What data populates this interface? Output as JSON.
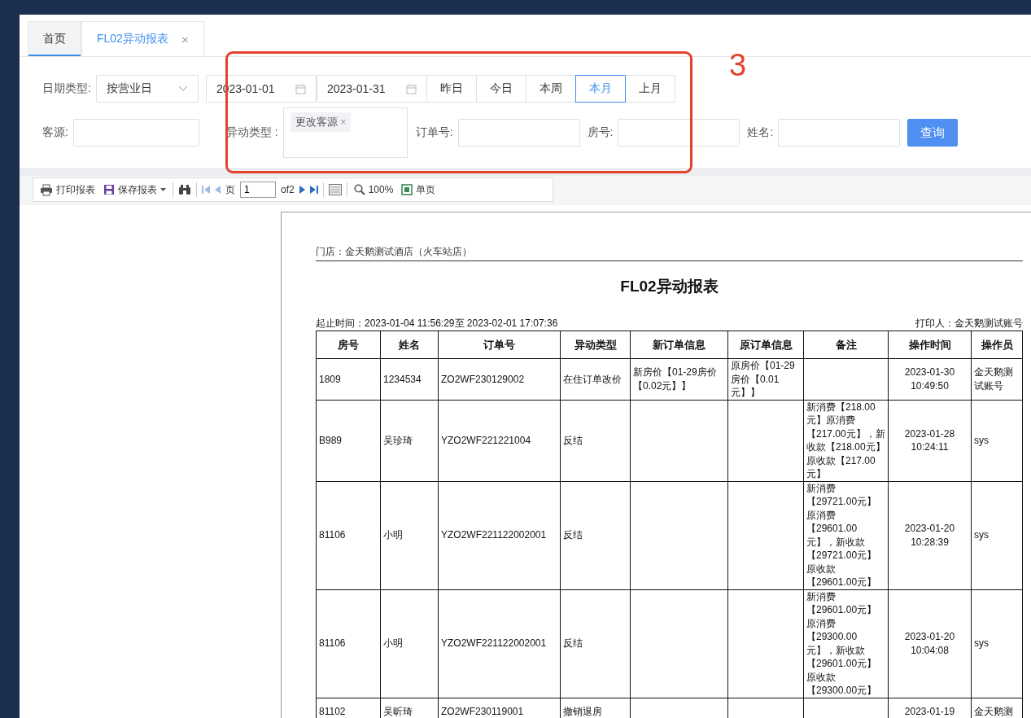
{
  "tabs": [
    {
      "label": "首页",
      "selected": false,
      "underlined": true
    },
    {
      "label": "FL02异动报表",
      "selected": true,
      "underlined": false,
      "close": "×"
    }
  ],
  "filters": {
    "date_type": {
      "label": "日期类型:",
      "value": "按营业日"
    },
    "date_from": "2023-01-01",
    "date_to": "2023-01-31",
    "quick_ranges": [
      {
        "label": "昨日",
        "selected": false
      },
      {
        "label": "今日",
        "selected": false
      },
      {
        "label": "本周",
        "selected": false
      },
      {
        "label": "本月",
        "selected": true
      },
      {
        "label": "上月",
        "selected": false
      }
    ],
    "source": {
      "label": "客源:"
    },
    "change_type": {
      "label": "异动类型 :",
      "tags": [
        {
          "text": "更改客源",
          "remove": "×"
        }
      ]
    },
    "order_no": {
      "label": "订单号:"
    },
    "room_no": {
      "label": "房号:"
    },
    "name": {
      "label": "姓名:"
    },
    "query_button": "查询"
  },
  "toolbar": {
    "print": "打印报表",
    "save": "保存报表",
    "page_label": "页",
    "page_input": "1",
    "page_total": "of2",
    "zoom": "100%",
    "single_page": "单页"
  },
  "report": {
    "store": "门店：金天鹅测试酒店（火车站店）",
    "title": "FL02异动报表",
    "period": "起止时间：2023-01-04 11:56:29至 2023-02-01 17:07:36",
    "printer": "打印人：金天鹅测试账号",
    "columns": [
      "房号",
      "姓名",
      "订单号",
      "异动类型",
      "新订单信息",
      "原订单信息",
      "备注",
      "操作时间",
      "操作员"
    ],
    "rows": [
      [
        "1809",
        "1234534",
        "ZO2WF230129002",
        "在住订单改价",
        "新房价【01-29房价【0.02元】】",
        "原房价【01-29房价【0.01元】】",
        "",
        "2023-01-30 10:49:50",
        "金天鹅测试账号"
      ],
      [
        "B989",
        "吴珍琦",
        "YZO2WF221221004",
        "反结",
        "",
        "",
        "新消费【218.00元】原消费【217.00元】，新收款【218.00元】原收款【217.00元】",
        "2023-01-28 10:24:11",
        "sys"
      ],
      [
        "81106",
        "小明",
        "YZO2WF221122002001",
        "反结",
        "",
        "",
        "新消费【29721.00元】原消费【29601.00元】，新收款【29721.00元】原收款【29601.00元】",
        "2023-01-20 10:28:39",
        "sys"
      ],
      [
        "81106",
        "小明",
        "YZO2WF221122002001",
        "反结",
        "",
        "",
        "新消费【29601.00元】原消费【29300.00元】，新收款【29601.00元】原收款【29300.00元】",
        "2023-01-20 10:04:08",
        "sys"
      ],
      [
        "81102",
        "吴昕琦",
        "ZO2WF230119001",
        "撤销退房",
        "",
        "",
        "",
        "2023-01-19",
        "金天鹅测"
      ]
    ]
  },
  "annotation": {
    "number": "3"
  }
}
